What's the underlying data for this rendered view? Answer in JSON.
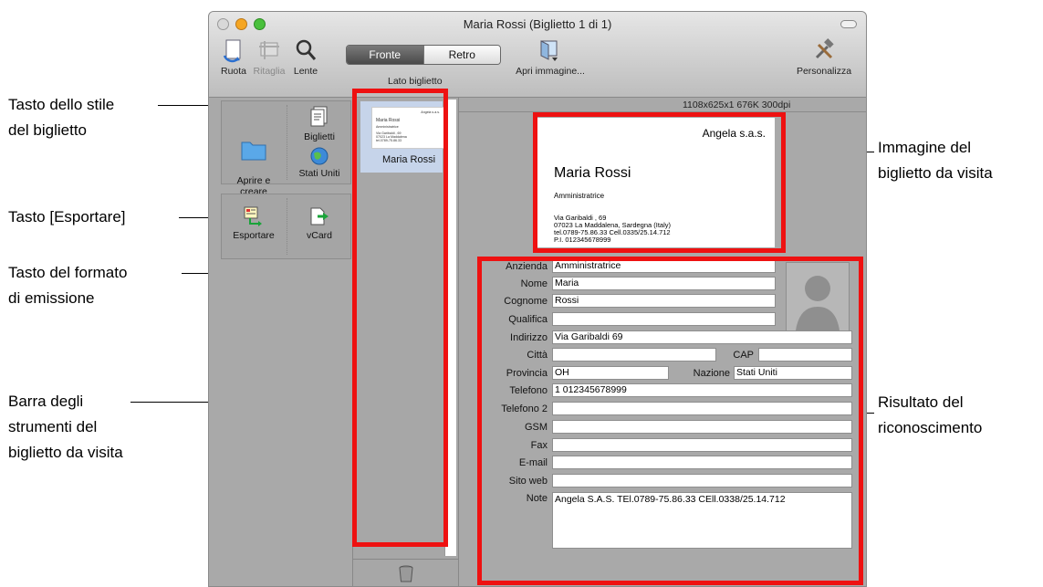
{
  "window": {
    "title": "Maria Rossi (Biglietto 1 di 1)"
  },
  "toolbar": {
    "rotate_label": "Ruota",
    "crop_label": "Ritaglia",
    "lens_label": "Lente",
    "side_front_label": "Fronte",
    "side_back_label": "Retro",
    "side_caption": "Lato biglietto",
    "open_image_label": "Apri immagine...",
    "customize_label": "Personalizza"
  },
  "tools": {
    "open_create_label": "Aprire e\ncreare",
    "cards_label": "Biglietti",
    "country_label": "Stati Uniti",
    "export_label": "Esportare",
    "vcard_label": "vCard"
  },
  "list": {
    "items": [
      {
        "name": "Maria Rossi"
      }
    ],
    "thumb_lines": [
      "Angela s.a.s.",
      "Maria Rossi",
      "Amministratrice",
      "Via Garibaldi , 69",
      "07023 La Maddalena",
      "tel.0789-75.86.33"
    ]
  },
  "image_info": "1108x625x1  676K  300dpi",
  "card": {
    "company": "Angela s.a.s.",
    "name": "Maria Rossi",
    "role": "Amministratrice",
    "address_lines": [
      "Via Garibaldi , 69",
      "07023 La Maddalena, Sardegna (Italy)",
      "tel.0789-75.86.33   Cell.0335/25.14.712",
      "P.I. 012345678999"
    ]
  },
  "form": {
    "fields": {
      "azienda": {
        "label": "Anzienda",
        "value": "Amministratrice"
      },
      "nome": {
        "label": "Nome",
        "value": "Maria"
      },
      "cognome": {
        "label": "Cognome",
        "value": "Rossi"
      },
      "qualifica": {
        "label": "Qualifica",
        "value": ""
      },
      "indirizzo": {
        "label": "Indirizzo",
        "value": "Via Garibaldi 69"
      },
      "citta": {
        "label": "Città",
        "value": ""
      },
      "cap": {
        "label": "CAP",
        "value": ""
      },
      "provincia": {
        "label": "Provincia",
        "value": "OH"
      },
      "nazione": {
        "label": "Nazione",
        "value": "Stati Uniti"
      },
      "telefono": {
        "label": "Telefono",
        "value": "1 012345678999"
      },
      "telefono2": {
        "label": "Telefono 2",
        "value": ""
      },
      "gsm": {
        "label": "GSM",
        "value": ""
      },
      "fax": {
        "label": "Fax",
        "value": ""
      },
      "email": {
        "label": "E-mail",
        "value": ""
      },
      "sitoweb": {
        "label": "Sito web",
        "value": ""
      },
      "note": {
        "label": "Note",
        "value": "Angela S.A.S. TEl.0789-75.86.33 CEll.0338/25.14.712"
      }
    }
  },
  "callouts": {
    "stile": "Tasto dello stile\ndel biglietto",
    "esportare": "Tasto [Esportare]",
    "formato": "Tasto del formato\ndi emissione",
    "barra": "Barra degli\nstrumenti del\nbiglietto da visita",
    "immagine": "Immagine del\nbiglietto da visita",
    "risultato": "Risultato del\nriconoscimento"
  },
  "colors": {
    "highlight": "#ee1111",
    "window_bg": "#aaaaaa",
    "selection": "#c6d4ea"
  }
}
